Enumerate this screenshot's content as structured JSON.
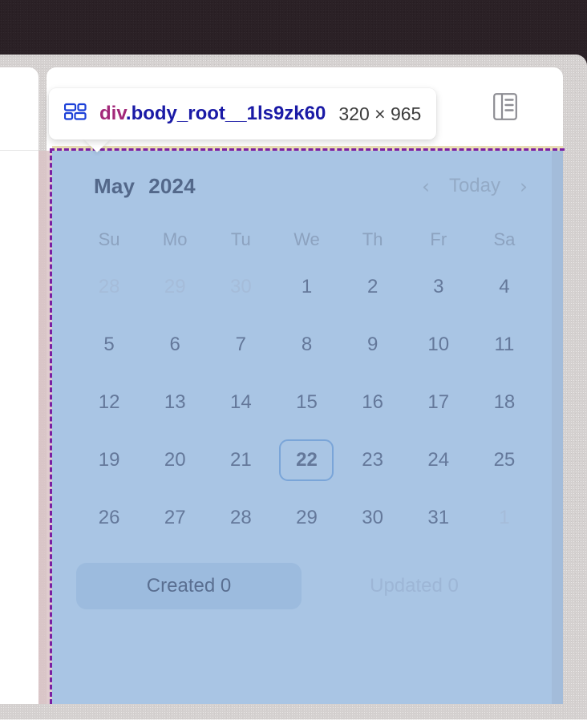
{
  "overlay": {
    "accent_dashed_color": "#7b1fa2",
    "content_highlight_color": "#a9c5e4",
    "padding_highlight_color": "#a3bcda",
    "margin_highlight_color": "#d9c3c6"
  },
  "tooltip": {
    "tag_name": "div",
    "class_name": ".body_root__1ls9zk60",
    "size_label": "320 × 965",
    "grid_icon": "grid-layout-icon",
    "badge_icon": "panel-icon"
  },
  "left_panel": {
    "pill_icon": "blue-rounded-button"
  },
  "calendar": {
    "month": "May",
    "year": "2024",
    "prev_arrow": "‹",
    "today_label": "Today",
    "next_arrow": "›",
    "weekdays": [
      "Su",
      "Mo",
      "Tu",
      "We",
      "Th",
      "Fr",
      "Sa"
    ],
    "weeks": [
      [
        {
          "day": "28",
          "muted": true,
          "today": false
        },
        {
          "day": "29",
          "muted": true,
          "today": false
        },
        {
          "day": "30",
          "muted": true,
          "today": false
        },
        {
          "day": "1",
          "muted": false,
          "today": false
        },
        {
          "day": "2",
          "muted": false,
          "today": false
        },
        {
          "day": "3",
          "muted": false,
          "today": false
        },
        {
          "day": "4",
          "muted": false,
          "today": false
        }
      ],
      [
        {
          "day": "5",
          "muted": false,
          "today": false
        },
        {
          "day": "6",
          "muted": false,
          "today": false
        },
        {
          "day": "7",
          "muted": false,
          "today": false
        },
        {
          "day": "8",
          "muted": false,
          "today": false
        },
        {
          "day": "9",
          "muted": false,
          "today": false
        },
        {
          "day": "10",
          "muted": false,
          "today": false
        },
        {
          "day": "11",
          "muted": false,
          "today": false
        }
      ],
      [
        {
          "day": "12",
          "muted": false,
          "today": false
        },
        {
          "day": "13",
          "muted": false,
          "today": false
        },
        {
          "day": "14",
          "muted": false,
          "today": false
        },
        {
          "day": "15",
          "muted": false,
          "today": false
        },
        {
          "day": "16",
          "muted": false,
          "today": false
        },
        {
          "day": "17",
          "muted": false,
          "today": false
        },
        {
          "day": "18",
          "muted": false,
          "today": false
        }
      ],
      [
        {
          "day": "19",
          "muted": false,
          "today": false
        },
        {
          "day": "20",
          "muted": false,
          "today": false
        },
        {
          "day": "21",
          "muted": false,
          "today": false
        },
        {
          "day": "22",
          "muted": false,
          "today": true
        },
        {
          "day": "23",
          "muted": false,
          "today": false
        },
        {
          "day": "24",
          "muted": false,
          "today": false
        },
        {
          "day": "25",
          "muted": false,
          "today": false
        }
      ],
      [
        {
          "day": "26",
          "muted": false,
          "today": false
        },
        {
          "day": "27",
          "muted": false,
          "today": false
        },
        {
          "day": "28",
          "muted": false,
          "today": false
        },
        {
          "day": "29",
          "muted": false,
          "today": false
        },
        {
          "day": "30",
          "muted": false,
          "today": false
        },
        {
          "day": "31",
          "muted": false,
          "today": false
        },
        {
          "day": "1",
          "muted": true,
          "today": false
        }
      ]
    ],
    "footer_tabs": [
      {
        "label": "Created 0",
        "active": true
      },
      {
        "label": "Updated 0",
        "active": false
      }
    ]
  }
}
